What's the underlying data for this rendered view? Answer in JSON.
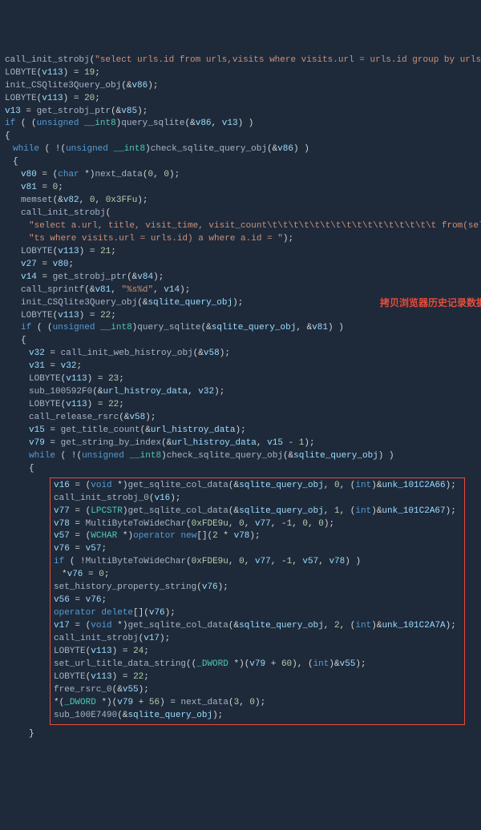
{
  "annotation": "拷贝浏览器历史记录数据",
  "code": {
    "l01": "call_init_strobj(\"select urls.id from urls,visits where visits.url = urls.id group by urls.id\");",
    "l02": "LOBYTE(v113) = 19;",
    "l03": "init_CSQlite3Query_obj(&v86);",
    "l04": "LOBYTE(v113) = 20;",
    "l05": "v13 = get_strobj_ptr(&v85);",
    "l06": "if ( (unsigned __int8)query_sqlite(&v86, v13) )",
    "l07": "{",
    "l08": "while ( !(unsigned __int8)check_sqlite_query_obj(&v86) )",
    "l09": "{",
    "l10": "v80 = (char *)next_data(0, 0);",
    "l11": "v81 = 0;",
    "l12": "memset(&v82, 0, 0x3FFu);",
    "l13": "call_init_strobj(",
    "l14": "\"select a.url, title, visit_time, visit_count\\t\\t\\t\\t\\t\\t\\t\\t\\t\\t\\t\\t\\t\\t\\t\\t from(select * from urls, visi\"",
    "l15": "\"ts where visits.url = urls.id) a where a.id = \");",
    "l16": "LOBYTE(v113) = 21;",
    "l17": "v27 = v80;",
    "l18": "v14 = get_strobj_ptr(&v84);",
    "l19": "call_sprintf(&v81, \"%s%d\", v14);",
    "l20": "init_CSQlite3Query_obj(&sqlite_query_obj);",
    "l21": "LOBYTE(v113) = 22;",
    "l22": "if ( (unsigned __int8)query_sqlite(&sqlite_query_obj, &v81) )",
    "l23": "{",
    "l24": "v32 = call_init_web_histroy_obj(&v58);",
    "l25": "v31 = v32;",
    "l26": "LOBYTE(v113) = 23;",
    "l27": "sub_100592F0(&url_histroy_data, v32);",
    "l28": "LOBYTE(v113) = 22;",
    "l29": "call_release_rsrc(&v58);",
    "l30": "v15 = get_title_count(&url_histroy_data);",
    "l31": "v79 = get_string_by_index(&url_histroy_data, v15 - 1);",
    "l32": "while ( !(unsigned __int8)check_sqlite_query_obj(&sqlite_query_obj) )",
    "l33": "{",
    "b01": "v16 = (void *)get_sqlite_col_data(&sqlite_query_obj, 0, (int)&unk_101C2A66);",
    "b02": "call_init_strobj_0(v16);",
    "b03": "v77 = (LPCSTR)get_sqlite_col_data(&sqlite_query_obj, 1, (int)&unk_101C2A67);",
    "b04": "v78 = MultiByteToWideChar(0xFDE9u, 0, v77, -1, 0, 0);",
    "b05": "v57 = (WCHAR *)operator new[](2 * v78);",
    "b06": "v76 = v57;",
    "b07": "if ( !MultiByteToWideChar(0xFDE9u, 0, v77, -1, v57, v78) )",
    "b08": "*v76 = 0;",
    "b09": "set_history_property_string(v76);",
    "b10": "v56 = v76;",
    "b11": "operator delete[](v76);",
    "b12": "v17 = (void *)get_sqlite_col_data(&sqlite_query_obj, 2, (int)&unk_101C2A7A);",
    "b13": "call_init_strobj(v17);",
    "b14": "LOBYTE(v113) = 24;",
    "b15": "set_url_title_data_string((_DWORD *)(v79 + 60), (int)&v55);",
    "b16": "LOBYTE(v113) = 22;",
    "b17": "free_rsrc_0(&v55);",
    "b18": "*(_DWORD *)(v79 + 56) = next_data(3, 0);",
    "b19": "sub_100E7490(&sqlite_query_obj);",
    "l34": "}"
  }
}
